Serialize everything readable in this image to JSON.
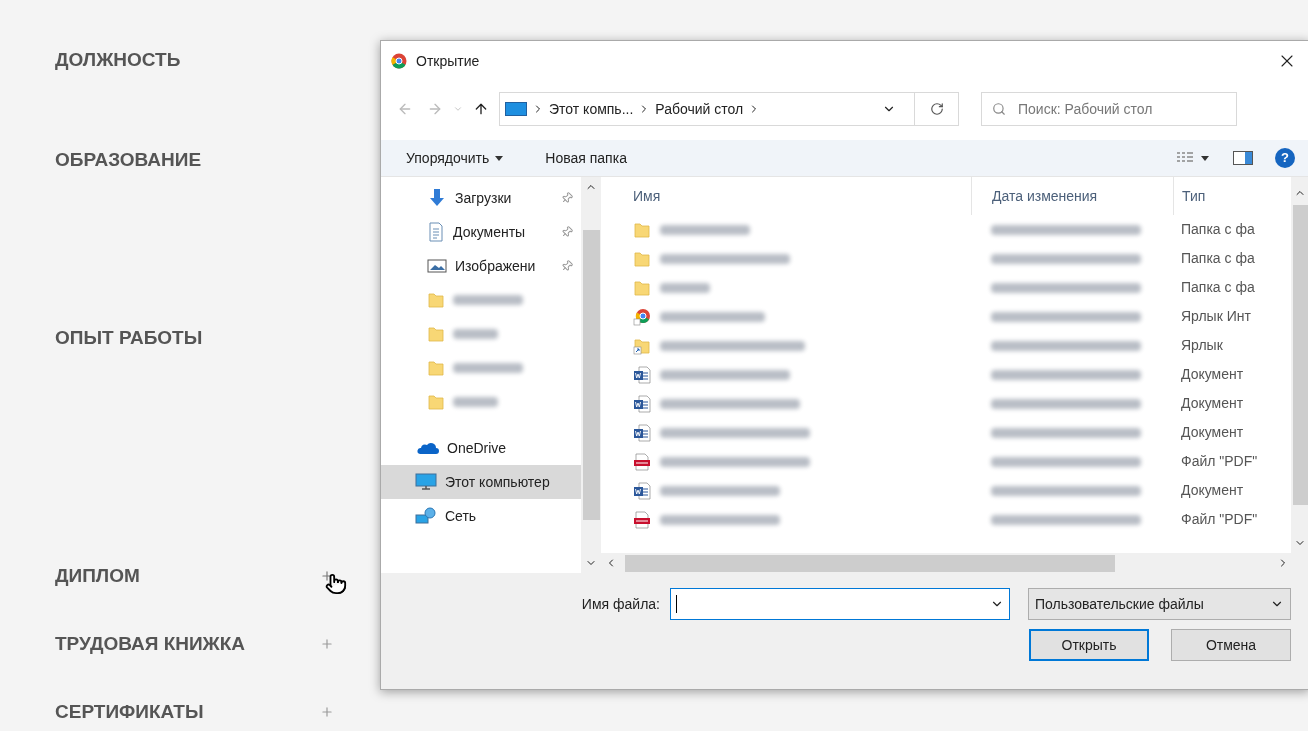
{
  "form_sections": [
    {
      "label": "ДОЛЖНОСТЬ",
      "kind": "plain"
    },
    {
      "label": "ОБРАЗОВАНИЕ",
      "kind": "plain"
    },
    {
      "label": "ОПЫТ РАБОТЫ",
      "kind": "plain"
    },
    {
      "label": "ДИПЛОМ",
      "kind": "attach",
      "hovered": true
    },
    {
      "label": "ТРУДОВАЯ КНИЖКА",
      "kind": "attach",
      "hovered": false
    },
    {
      "label": "СЕРТИФИКАТЫ",
      "kind": "attach",
      "hovered": false
    }
  ],
  "dialog": {
    "title": "Открытие",
    "address": {
      "crumbs": [
        "Этот компь...",
        "Рабочий стол"
      ]
    },
    "search": {
      "placeholder": "Поиск: Рабочий стол"
    },
    "toolbar": {
      "organize": "Упорядочить",
      "new_folder": "Новая папка"
    },
    "help_button": "?",
    "nav_items": [
      {
        "kind": "downloads",
        "label": "Загрузки",
        "pinned": true,
        "selected": false
      },
      {
        "kind": "documents",
        "label": "Документы",
        "pinned": true,
        "selected": false
      },
      {
        "kind": "pictures",
        "label": "Изображени",
        "pinned": true,
        "selected": false
      },
      {
        "kind": "folder",
        "pinned": false,
        "selected": false
      },
      {
        "kind": "folder",
        "pinned": false,
        "selected": false
      },
      {
        "kind": "folder",
        "pinned": false,
        "selected": false
      },
      {
        "kind": "folder",
        "pinned": false,
        "selected": false
      },
      {
        "kind": "onedrive",
        "label": "OneDrive",
        "pinned": false,
        "selected": false
      },
      {
        "kind": "computer",
        "label": "Этот компьютер",
        "pinned": false,
        "selected": true
      },
      {
        "kind": "network",
        "label": "Сеть",
        "pinned": false,
        "selected": false
      }
    ],
    "columns": [
      "Имя",
      "Дата изменения",
      "Тип"
    ],
    "files": [
      {
        "kind": "folder",
        "type": "Папка с фа"
      },
      {
        "kind": "folder",
        "type": "Папка с фа"
      },
      {
        "kind": "folder",
        "type": "Папка с фа"
      },
      {
        "kind": "browser-shortcut",
        "type": "Ярлык Инт"
      },
      {
        "kind": "folder-shortcut",
        "type": "Ярлык"
      },
      {
        "kind": "word",
        "type": "Документ"
      },
      {
        "kind": "word",
        "type": "Документ"
      },
      {
        "kind": "word",
        "type": "Документ"
      },
      {
        "kind": "pdf",
        "type": "Файл \"PDF\""
      },
      {
        "kind": "word",
        "type": "Документ"
      },
      {
        "kind": "pdf",
        "type": "Файл \"PDF\""
      }
    ],
    "file_name_label": "Имя файла:",
    "file_type": "Пользовательские файлы",
    "buttons": [
      {
        "label": "Открыть",
        "default": true
      },
      {
        "label": "Отмена",
        "default": false
      }
    ]
  }
}
